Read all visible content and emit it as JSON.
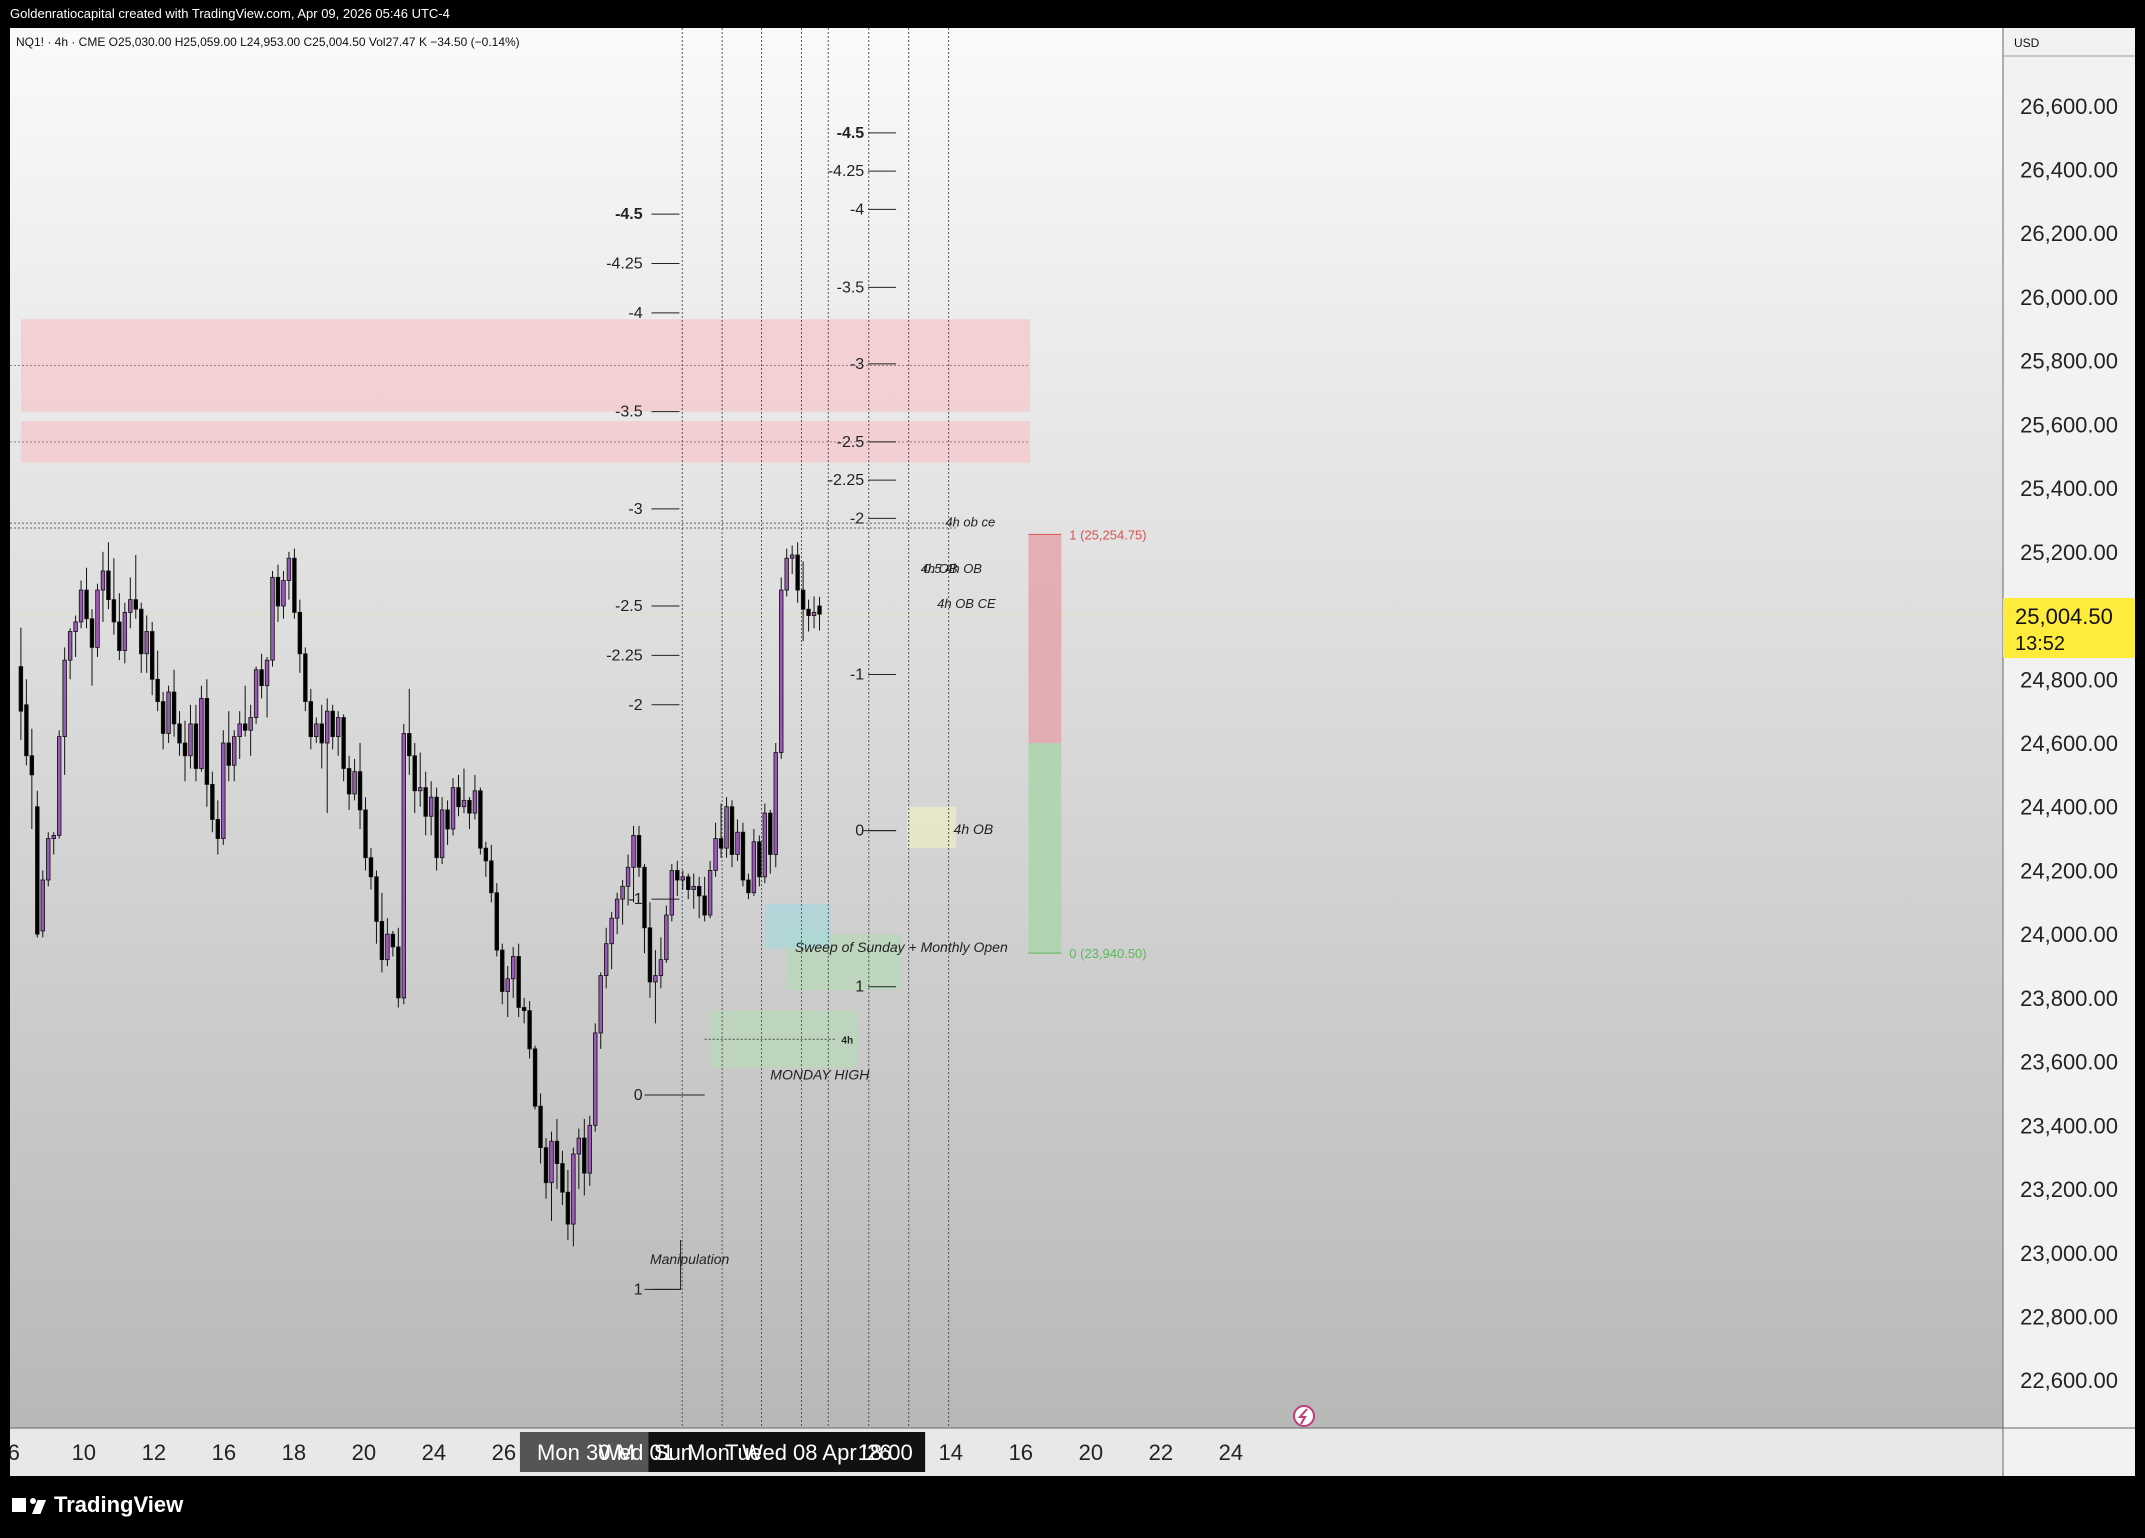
{
  "header": {
    "text": "Goldenratiocapital created with TradingView.com, Apr 09, 2026 05:46 UTC-4"
  },
  "legend": {
    "text": "NQ1! · 4h · CME  O25,030.00  H25,059.00  L24,953.00  C25,004.50  Vol27.47 K  −34.50 (−0.14%)"
  },
  "currency": "USD",
  "brand": {
    "name": "TradingView"
  },
  "colors": {
    "bull": "#9b59b6",
    "bear": "#000000",
    "accent": "#ffeb3b",
    "red_zone": "#f4c7cc",
    "green_zone": "#b7d8b7"
  },
  "chart_data": {
    "type": "candlestick",
    "symbol": "NQ1!",
    "timeframe": "4h",
    "ylim": [
      22450,
      26750
    ],
    "y_ticks": [
      22600,
      22800,
      23000,
      23200,
      23400,
      23600,
      23800,
      24000,
      24200,
      24400,
      24600,
      24800,
      25000,
      25200,
      25400,
      25600,
      25800,
      26000,
      26200,
      26400,
      26600
    ],
    "y_tick_labels": [
      "22,600.00",
      "22,800.00",
      "23,000.00",
      "23,200.00",
      "23,400.00",
      "23,600.00",
      "23,800.00",
      "24,000.00",
      "24,200.00",
      "24,400.00",
      "24,600.00",
      "24,800.00",
      "25,000.00",
      "25,200.00",
      "25,400.00",
      "25,600.00",
      "25,800.00",
      "26,000.00",
      "26,200.00",
      "26,400.00",
      "26,600.00"
    ],
    "last_price": {
      "label": "25,004.50",
      "countdown": "13:52",
      "value": 25004.5
    },
    "x_labels": [
      {
        "label": "6",
        "i": -1.3
      },
      {
        "label": "10",
        "i": 11.5
      },
      {
        "label": "12",
        "i": 24.3
      },
      {
        "label": "16",
        "i": 37.1
      },
      {
        "label": "18",
        "i": 49.9
      },
      {
        "label": "20",
        "i": 62.7
      },
      {
        "label": "24",
        "i": 75.5
      },
      {
        "label": "26",
        "i": 88.3
      },
      {
        "label": "14",
        "i": 170
      },
      {
        "label": "16",
        "i": 182.8
      },
      {
        "label": "20",
        "i": 195.6
      },
      {
        "label": "22",
        "i": 208.4
      },
      {
        "label": "24",
        "i": 221.2
      }
    ],
    "x_labels_boxed": [
      {
        "label": "Mon 30 M",
        "i": 103.3,
        "w": 132
      },
      {
        "label": "Wed 01",
        "i": 112.5,
        "w": 80
      },
      {
        "label": "Sun",
        "i": 119.3,
        "w": 50
      },
      {
        "label": "Mon",
        "i": 125.7,
        "w": 50
      },
      {
        "label": "Tue",
        "i": 132.1,
        "w": 48
      },
      {
        "label": "Wed 08 Apr '26",
        "i": 145.5,
        "w": 166
      },
      {
        "label": "18:00",
        "i": 158.0,
        "w": 80
      }
    ],
    "candles": [
      [
        24840,
        24962,
        24610,
        24700
      ],
      [
        24720,
        24800,
        24530,
        24560
      ],
      [
        24560,
        24645,
        24330,
        24500
      ],
      [
        24400,
        24450,
        23990,
        24000
      ],
      [
        24010,
        24200,
        23990,
        24170
      ],
      [
        24170,
        24320,
        24150,
        24300
      ],
      [
        24300,
        24320,
        24250,
        24310
      ],
      [
        24310,
        24640,
        24300,
        24620
      ],
      [
        24620,
        24900,
        24500,
        24860
      ],
      [
        24860,
        24960,
        24800,
        24950
      ],
      [
        24950,
        25000,
        24870,
        24980
      ],
      [
        24980,
        25110,
        24960,
        25080
      ],
      [
        25080,
        25150,
        24960,
        24990
      ],
      [
        24990,
        25020,
        24780,
        24900
      ],
      [
        24900,
        25100,
        24870,
        25080
      ],
      [
        25080,
        25200,
        24980,
        25140
      ],
      [
        25140,
        25230,
        25020,
        25050
      ],
      [
        25050,
        25180,
        24940,
        24980
      ],
      [
        24980,
        25070,
        24860,
        24890
      ],
      [
        24890,
        25040,
        24850,
        25010
      ],
      [
        25010,
        25120,
        24960,
        25050
      ],
      [
        25050,
        25190,
        24990,
        25020
      ],
      [
        25020,
        25040,
        24820,
        24880
      ],
      [
        24880,
        25000,
        24820,
        24950
      ],
      [
        24950,
        24980,
        24750,
        24800
      ],
      [
        24800,
        24890,
        24700,
        24730
      ],
      [
        24730,
        24760,
        24580,
        24630
      ],
      [
        24630,
        24780,
        24600,
        24760
      ],
      [
        24760,
        24830,
        24620,
        24660
      ],
      [
        24660,
        24700,
        24560,
        24600
      ],
      [
        24600,
        24670,
        24480,
        24560
      ],
      [
        24560,
        24720,
        24520,
        24660
      ],
      [
        24660,
        24720,
        24480,
        24520
      ],
      [
        24520,
        24780,
        24510,
        24740
      ],
      [
        24740,
        24800,
        24400,
        24470
      ],
      [
        24470,
        24510,
        24320,
        24360
      ],
      [
        24360,
        24420,
        24250,
        24300
      ],
      [
        24300,
        24640,
        24280,
        24600
      ],
      [
        24600,
        24700,
        24480,
        24530
      ],
      [
        24530,
        24640,
        24480,
        24620
      ],
      [
        24620,
        24700,
        24550,
        24660
      ],
      [
        24660,
        24780,
        24620,
        24640
      ],
      [
        24640,
        24720,
        24560,
        24680
      ],
      [
        24680,
        24840,
        24660,
        24830
      ],
      [
        24830,
        24880,
        24740,
        24780
      ],
      [
        24780,
        24870,
        24680,
        24860
      ],
      [
        24860,
        25140,
        24840,
        25120
      ],
      [
        25120,
        25160,
        24980,
        25030
      ],
      [
        25030,
        25140,
        24990,
        25110
      ],
      [
        25110,
        25200,
        25050,
        25180
      ],
      [
        25180,
        25210,
        24990,
        25010
      ],
      [
        25010,
        25050,
        24820,
        24880
      ],
      [
        24880,
        24900,
        24700,
        24730
      ],
      [
        24730,
        24770,
        24580,
        24620
      ],
      [
        24620,
        24680,
        24600,
        24660
      ],
      [
        24660,
        24720,
        24520,
        24600
      ],
      [
        24600,
        24740,
        24380,
        24700
      ],
      [
        24700,
        24720,
        24580,
        24620
      ],
      [
        24620,
        24700,
        24560,
        24680
      ],
      [
        24680,
        24690,
        24480,
        24520
      ],
      [
        24520,
        24560,
        24390,
        24440
      ],
      [
        24440,
        24550,
        24420,
        24510
      ],
      [
        24510,
        24600,
        24330,
        24390
      ],
      [
        24390,
        24430,
        24200,
        24240
      ],
      [
        24240,
        24270,
        24140,
        24180
      ],
      [
        24180,
        24200,
        23970,
        24040
      ],
      [
        24040,
        24130,
        23880,
        23920
      ],
      [
        23920,
        24050,
        23900,
        24000
      ],
      [
        24000,
        24010,
        23930,
        23960
      ],
      [
        23960,
        24020,
        23770,
        23800
      ],
      [
        23800,
        24660,
        23780,
        24630
      ],
      [
        24630,
        24770,
        24500,
        24560
      ],
      [
        24560,
        24600,
        24380,
        24450
      ],
      [
        24450,
        24570,
        24400,
        24460
      ],
      [
        24460,
        24510,
        24310,
        24370
      ],
      [
        24370,
        24480,
        24310,
        24430
      ],
      [
        24430,
        24460,
        24200,
        24240
      ],
      [
        24240,
        24430,
        24220,
        24390
      ],
      [
        24390,
        24420,
        24280,
        24330
      ],
      [
        24330,
        24490,
        24310,
        24460
      ],
      [
        24460,
        24500,
        24370,
        24400
      ],
      [
        24400,
        24520,
        24380,
        24420
      ],
      [
        24420,
        24430,
        24330,
        24380
      ],
      [
        24380,
        24500,
        24360,
        24450
      ],
      [
        24450,
        24460,
        24250,
        24270
      ],
      [
        24270,
        24290,
        24180,
        24230
      ],
      [
        24230,
        24280,
        24100,
        24130
      ],
      [
        24130,
        24160,
        23930,
        23950
      ],
      [
        23950,
        23970,
        23780,
        23820
      ],
      [
        23820,
        23900,
        23740,
        23860
      ],
      [
        23860,
        23960,
        23800,
        23930
      ],
      [
        23930,
        23970,
        23740,
        23770
      ],
      [
        23770,
        23800,
        23720,
        23760
      ],
      [
        23760,
        23790,
        23610,
        23640
      ],
      [
        23640,
        23650,
        23450,
        23460
      ],
      [
        23460,
        23500,
        23280,
        23330
      ],
      [
        23330,
        23360,
        23170,
        23220
      ],
      [
        23220,
        23380,
        23100,
        23350
      ],
      [
        23350,
        23420,
        23200,
        23280
      ],
      [
        23280,
        23320,
        23150,
        23190
      ],
      [
        23190,
        23260,
        23040,
        23090
      ],
      [
        23090,
        23330,
        23020,
        23310
      ],
      [
        23310,
        23390,
        23200,
        23360
      ],
      [
        23360,
        23420,
        23180,
        23250
      ],
      [
        23250,
        23430,
        23210,
        23400
      ],
      [
        23400,
        23720,
        23380,
        23690
      ],
      [
        23690,
        23880,
        23640,
        23870
      ],
      [
        23870,
        24020,
        23830,
        23970
      ],
      [
        23970,
        24070,
        23890,
        24050
      ],
      [
        24050,
        24130,
        24000,
        24110
      ],
      [
        24110,
        24170,
        24030,
        24150
      ],
      [
        24150,
        24250,
        24090,
        24210
      ],
      [
        24210,
        24340,
        24100,
        24310
      ],
      [
        24310,
        24340,
        24180,
        24210
      ],
      [
        24210,
        24220,
        23940,
        24020
      ],
      [
        24020,
        24100,
        23800,
        23850
      ],
      [
        23850,
        23950,
        23720,
        23870
      ],
      [
        23870,
        23990,
        23830,
        23920
      ],
      [
        23920,
        24090,
        23910,
        24060
      ],
      [
        24060,
        24220,
        24040,
        24200
      ],
      [
        24200,
        24230,
        24120,
        24170
      ],
      [
        24170,
        24200,
        24140,
        24180
      ],
      [
        24180,
        24190,
        24110,
        24140
      ],
      [
        24140,
        24190,
        24080,
        24150
      ],
      [
        24150,
        24180,
        24050,
        24120
      ],
      [
        24120,
        24180,
        24040,
        24060
      ],
      [
        24060,
        24230,
        24050,
        24200
      ],
      [
        24200,
        24350,
        24180,
        24300
      ],
      [
        24300,
        24410,
        24240,
        24270
      ],
      [
        24270,
        24430,
        24240,
        24400
      ],
      [
        24400,
        24420,
        24210,
        24250
      ],
      [
        24250,
        24360,
        24230,
        24320
      ],
      [
        24320,
        24350,
        24150,
        24170
      ],
      [
        24170,
        24190,
        24110,
        24130
      ],
      [
        24130,
        24330,
        24120,
        24290
      ],
      [
        24290,
        24310,
        24150,
        24180
      ],
      [
        24180,
        24410,
        24160,
        24380
      ],
      [
        24380,
        24390,
        24190,
        24250
      ],
      [
        24250,
        24600,
        24210,
        24570
      ],
      [
        24570,
        25120,
        24550,
        25080
      ],
      [
        25080,
        25210,
        25060,
        25180
      ],
      [
        25180,
        25220,
        25130,
        25190
      ],
      [
        25190,
        25230,
        25040,
        25080
      ],
      [
        25080,
        25170,
        24920,
        25020
      ],
      [
        25020,
        25050,
        24950,
        25000
      ],
      [
        25000,
        25060,
        24960,
        25010
      ],
      [
        25030,
        25059,
        24953,
        25004.5
      ]
    ],
    "fib_labels_left": [
      {
        "label": "-4.5",
        "y": 26260,
        "bold": true
      },
      {
        "label": "-4.25",
        "y": 26105
      },
      {
        "label": "-4",
        "y": 25950
      },
      {
        "label": "-3.5",
        "y": 25640
      },
      {
        "label": "-3",
        "y": 25335
      },
      {
        "label": "-2.5",
        "y": 25030
      },
      {
        "label": "-2.25",
        "y": 24875
      },
      {
        "label": "-2",
        "y": 24720
      },
      {
        "label": "-1",
        "y": 24110
      },
      {
        "label": "0",
        "y": 23495
      },
      {
        "label": "1",
        "y": 22885
      }
    ],
    "fib_labels_right": [
      {
        "label": "-4.5",
        "y": 26515,
        "bold": true
      },
      {
        "label": "-4.25",
        "y": 26395
      },
      {
        "label": "-4",
        "y": 26275
      },
      {
        "label": "-3.5",
        "y": 26030
      },
      {
        "label": "-3",
        "y": 25790
      },
      {
        "label": "-2.5",
        "y": 25545
      },
      {
        "label": "-2.25",
        "y": 25425
      },
      {
        "label": "-2",
        "y": 25305
      },
      {
        "label": "-1",
        "y": 24815
      },
      {
        "label": "0",
        "y": 24325
      },
      {
        "label": "1",
        "y": 23835
      }
    ],
    "zones": [
      {
        "kind": "red",
        "y1": 25640,
        "y2": 25930
      },
      {
        "kind": "red",
        "y1": 25480,
        "y2": 25610
      },
      {
        "kind": "green",
        "y1": 23580,
        "y2": 23760,
        "name": "4h"
      },
      {
        "kind": "green",
        "y1": 23825,
        "y2": 24000
      },
      {
        "kind": "teal",
        "y1": 23955,
        "y2": 24095
      },
      {
        "kind": "yellow",
        "y1": 24270,
        "y2": 24400,
        "name": "4h OB"
      }
    ],
    "annotations": [
      {
        "text": "Manipulation",
        "y": 22980
      },
      {
        "text": "MONDAY HIGH",
        "y": 23560
      },
      {
        "text": "Sweep of Sunday + Monthly Open",
        "y": 23960
      },
      {
        "text": "4h OB",
        "y": 24330
      },
      {
        "text": "4h ob ce",
        "y": 25295
      },
      {
        "text": "4h OB",
        "y": 25150
      },
      {
        "text": "0.5 4h OB",
        "y": 25150
      },
      {
        "text": "4h OB CE",
        "y": 25040
      }
    ],
    "position": {
      "target_label": "1 (25,254.75)",
      "target": 25254.75,
      "entry": 24600,
      "stop_label": "0 (23,940.50)",
      "stop": 23940.5
    }
  }
}
